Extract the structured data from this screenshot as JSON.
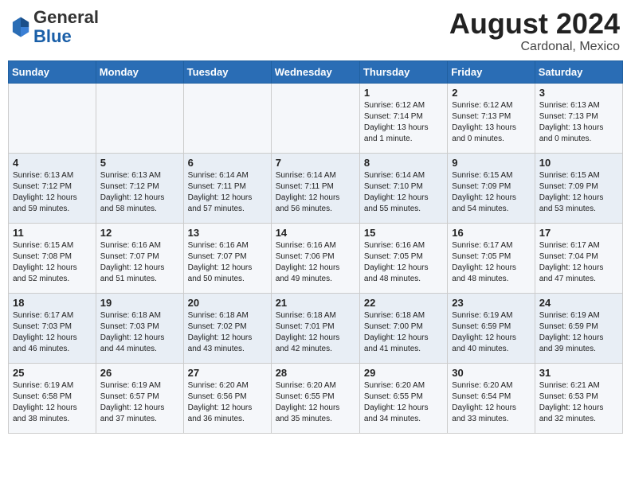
{
  "header": {
    "logo": {
      "general": "General",
      "blue": "Blue"
    },
    "month_year": "August 2024",
    "location": "Cardonal, Mexico"
  },
  "days_of_week": [
    "Sunday",
    "Monday",
    "Tuesday",
    "Wednesday",
    "Thursday",
    "Friday",
    "Saturday"
  ],
  "weeks": [
    [
      {
        "day": "",
        "info": ""
      },
      {
        "day": "",
        "info": ""
      },
      {
        "day": "",
        "info": ""
      },
      {
        "day": "",
        "info": ""
      },
      {
        "day": "1",
        "info": "Sunrise: 6:12 AM\nSunset: 7:14 PM\nDaylight: 13 hours\nand 1 minute."
      },
      {
        "day": "2",
        "info": "Sunrise: 6:12 AM\nSunset: 7:13 PM\nDaylight: 13 hours\nand 0 minutes."
      },
      {
        "day": "3",
        "info": "Sunrise: 6:13 AM\nSunset: 7:13 PM\nDaylight: 13 hours\nand 0 minutes."
      }
    ],
    [
      {
        "day": "4",
        "info": "Sunrise: 6:13 AM\nSunset: 7:12 PM\nDaylight: 12 hours\nand 59 minutes."
      },
      {
        "day": "5",
        "info": "Sunrise: 6:13 AM\nSunset: 7:12 PM\nDaylight: 12 hours\nand 58 minutes."
      },
      {
        "day": "6",
        "info": "Sunrise: 6:14 AM\nSunset: 7:11 PM\nDaylight: 12 hours\nand 57 minutes."
      },
      {
        "day": "7",
        "info": "Sunrise: 6:14 AM\nSunset: 7:11 PM\nDaylight: 12 hours\nand 56 minutes."
      },
      {
        "day": "8",
        "info": "Sunrise: 6:14 AM\nSunset: 7:10 PM\nDaylight: 12 hours\nand 55 minutes."
      },
      {
        "day": "9",
        "info": "Sunrise: 6:15 AM\nSunset: 7:09 PM\nDaylight: 12 hours\nand 54 minutes."
      },
      {
        "day": "10",
        "info": "Sunrise: 6:15 AM\nSunset: 7:09 PM\nDaylight: 12 hours\nand 53 minutes."
      }
    ],
    [
      {
        "day": "11",
        "info": "Sunrise: 6:15 AM\nSunset: 7:08 PM\nDaylight: 12 hours\nand 52 minutes."
      },
      {
        "day": "12",
        "info": "Sunrise: 6:16 AM\nSunset: 7:07 PM\nDaylight: 12 hours\nand 51 minutes."
      },
      {
        "day": "13",
        "info": "Sunrise: 6:16 AM\nSunset: 7:07 PM\nDaylight: 12 hours\nand 50 minutes."
      },
      {
        "day": "14",
        "info": "Sunrise: 6:16 AM\nSunset: 7:06 PM\nDaylight: 12 hours\nand 49 minutes."
      },
      {
        "day": "15",
        "info": "Sunrise: 6:16 AM\nSunset: 7:05 PM\nDaylight: 12 hours\nand 48 minutes."
      },
      {
        "day": "16",
        "info": "Sunrise: 6:17 AM\nSunset: 7:05 PM\nDaylight: 12 hours\nand 48 minutes."
      },
      {
        "day": "17",
        "info": "Sunrise: 6:17 AM\nSunset: 7:04 PM\nDaylight: 12 hours\nand 47 minutes."
      }
    ],
    [
      {
        "day": "18",
        "info": "Sunrise: 6:17 AM\nSunset: 7:03 PM\nDaylight: 12 hours\nand 46 minutes."
      },
      {
        "day": "19",
        "info": "Sunrise: 6:18 AM\nSunset: 7:03 PM\nDaylight: 12 hours\nand 44 minutes."
      },
      {
        "day": "20",
        "info": "Sunrise: 6:18 AM\nSunset: 7:02 PM\nDaylight: 12 hours\nand 43 minutes."
      },
      {
        "day": "21",
        "info": "Sunrise: 6:18 AM\nSunset: 7:01 PM\nDaylight: 12 hours\nand 42 minutes."
      },
      {
        "day": "22",
        "info": "Sunrise: 6:18 AM\nSunset: 7:00 PM\nDaylight: 12 hours\nand 41 minutes."
      },
      {
        "day": "23",
        "info": "Sunrise: 6:19 AM\nSunset: 6:59 PM\nDaylight: 12 hours\nand 40 minutes."
      },
      {
        "day": "24",
        "info": "Sunrise: 6:19 AM\nSunset: 6:59 PM\nDaylight: 12 hours\nand 39 minutes."
      }
    ],
    [
      {
        "day": "25",
        "info": "Sunrise: 6:19 AM\nSunset: 6:58 PM\nDaylight: 12 hours\nand 38 minutes."
      },
      {
        "day": "26",
        "info": "Sunrise: 6:19 AM\nSunset: 6:57 PM\nDaylight: 12 hours\nand 37 minutes."
      },
      {
        "day": "27",
        "info": "Sunrise: 6:20 AM\nSunset: 6:56 PM\nDaylight: 12 hours\nand 36 minutes."
      },
      {
        "day": "28",
        "info": "Sunrise: 6:20 AM\nSunset: 6:55 PM\nDaylight: 12 hours\nand 35 minutes."
      },
      {
        "day": "29",
        "info": "Sunrise: 6:20 AM\nSunset: 6:55 PM\nDaylight: 12 hours\nand 34 minutes."
      },
      {
        "day": "30",
        "info": "Sunrise: 6:20 AM\nSunset: 6:54 PM\nDaylight: 12 hours\nand 33 minutes."
      },
      {
        "day": "31",
        "info": "Sunrise: 6:21 AM\nSunset: 6:53 PM\nDaylight: 12 hours\nand 32 minutes."
      }
    ]
  ]
}
